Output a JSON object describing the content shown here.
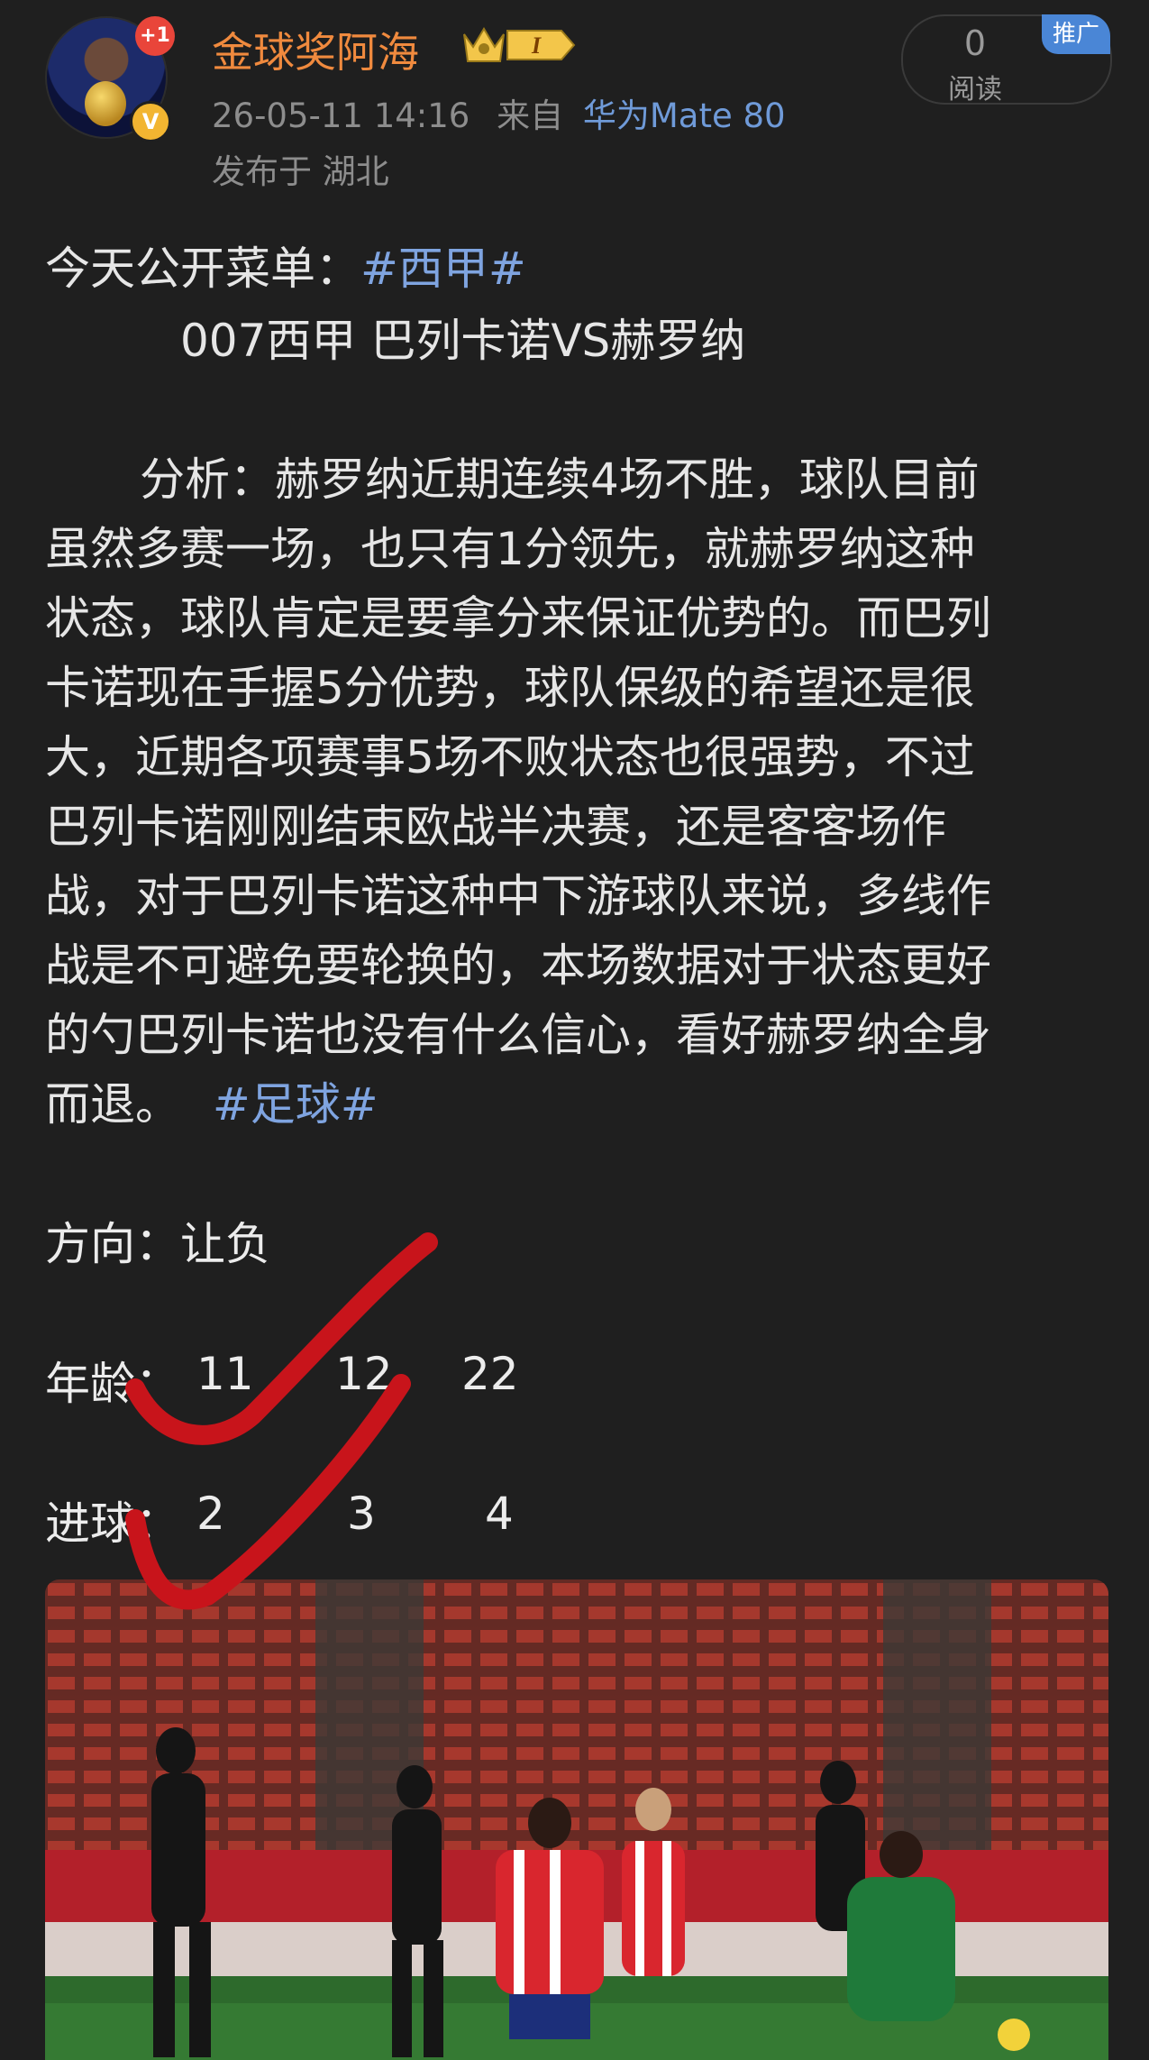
{
  "post": {
    "username": "金球奖阿海",
    "timestamp": "26-05-11 14:16",
    "source_prefix": "来自",
    "device": "华为Mate 80",
    "location": "发布于 湖北",
    "notification_badge": "+1",
    "verified_badge": "V",
    "read_count": "0",
    "read_label": "阅读",
    "promo_tag": "推广",
    "level_badge": "I",
    "icons": [
      "avatar",
      "crown-level-badge",
      "verified-icon"
    ]
  },
  "content": {
    "intro_label": "今天公开菜单：",
    "topic_tag": "#西甲#",
    "match_line": "007西甲 巴列卡诺VS赫罗纳",
    "analysis_lines": [
      "分析：赫罗纳近期连续4场不胜，球队目前",
      "虽然多赛一场，也只有1分领先，就赫罗纳这种",
      "状态，球队肯定是要拿分来保证优势的。而巴列",
      "卡诺现在手握5分优势，球队保级的希望还是很",
      "大，近期各项赛事5场不败状态也很强势，不过",
      "巴列卡诺刚刚结束欧战半决赛，还是客客场作",
      "战，对于巴列卡诺这种中下游球队来说，多线作",
      "战是不可避免要轮换的，本场数据对于状态更好",
      "的勺巴列卡诺也没有什么信心，看好赫罗纳全身"
    ],
    "closing_text": "而退。",
    "closing_tag": "#足球#",
    "direction_label": "方向：",
    "direction_value": "让负",
    "age_label": "年龄：",
    "age_values": [
      "11",
      "12",
      "22"
    ],
    "goals_label": "进球：",
    "goals_values": [
      "2",
      "3",
      "4"
    ]
  },
  "colors": {
    "background": "#1f1f1f",
    "username": "#f08a3e",
    "hashtag": "#7fa4e0",
    "checkmark": "#c8141b",
    "promo": "#4a86d6"
  }
}
